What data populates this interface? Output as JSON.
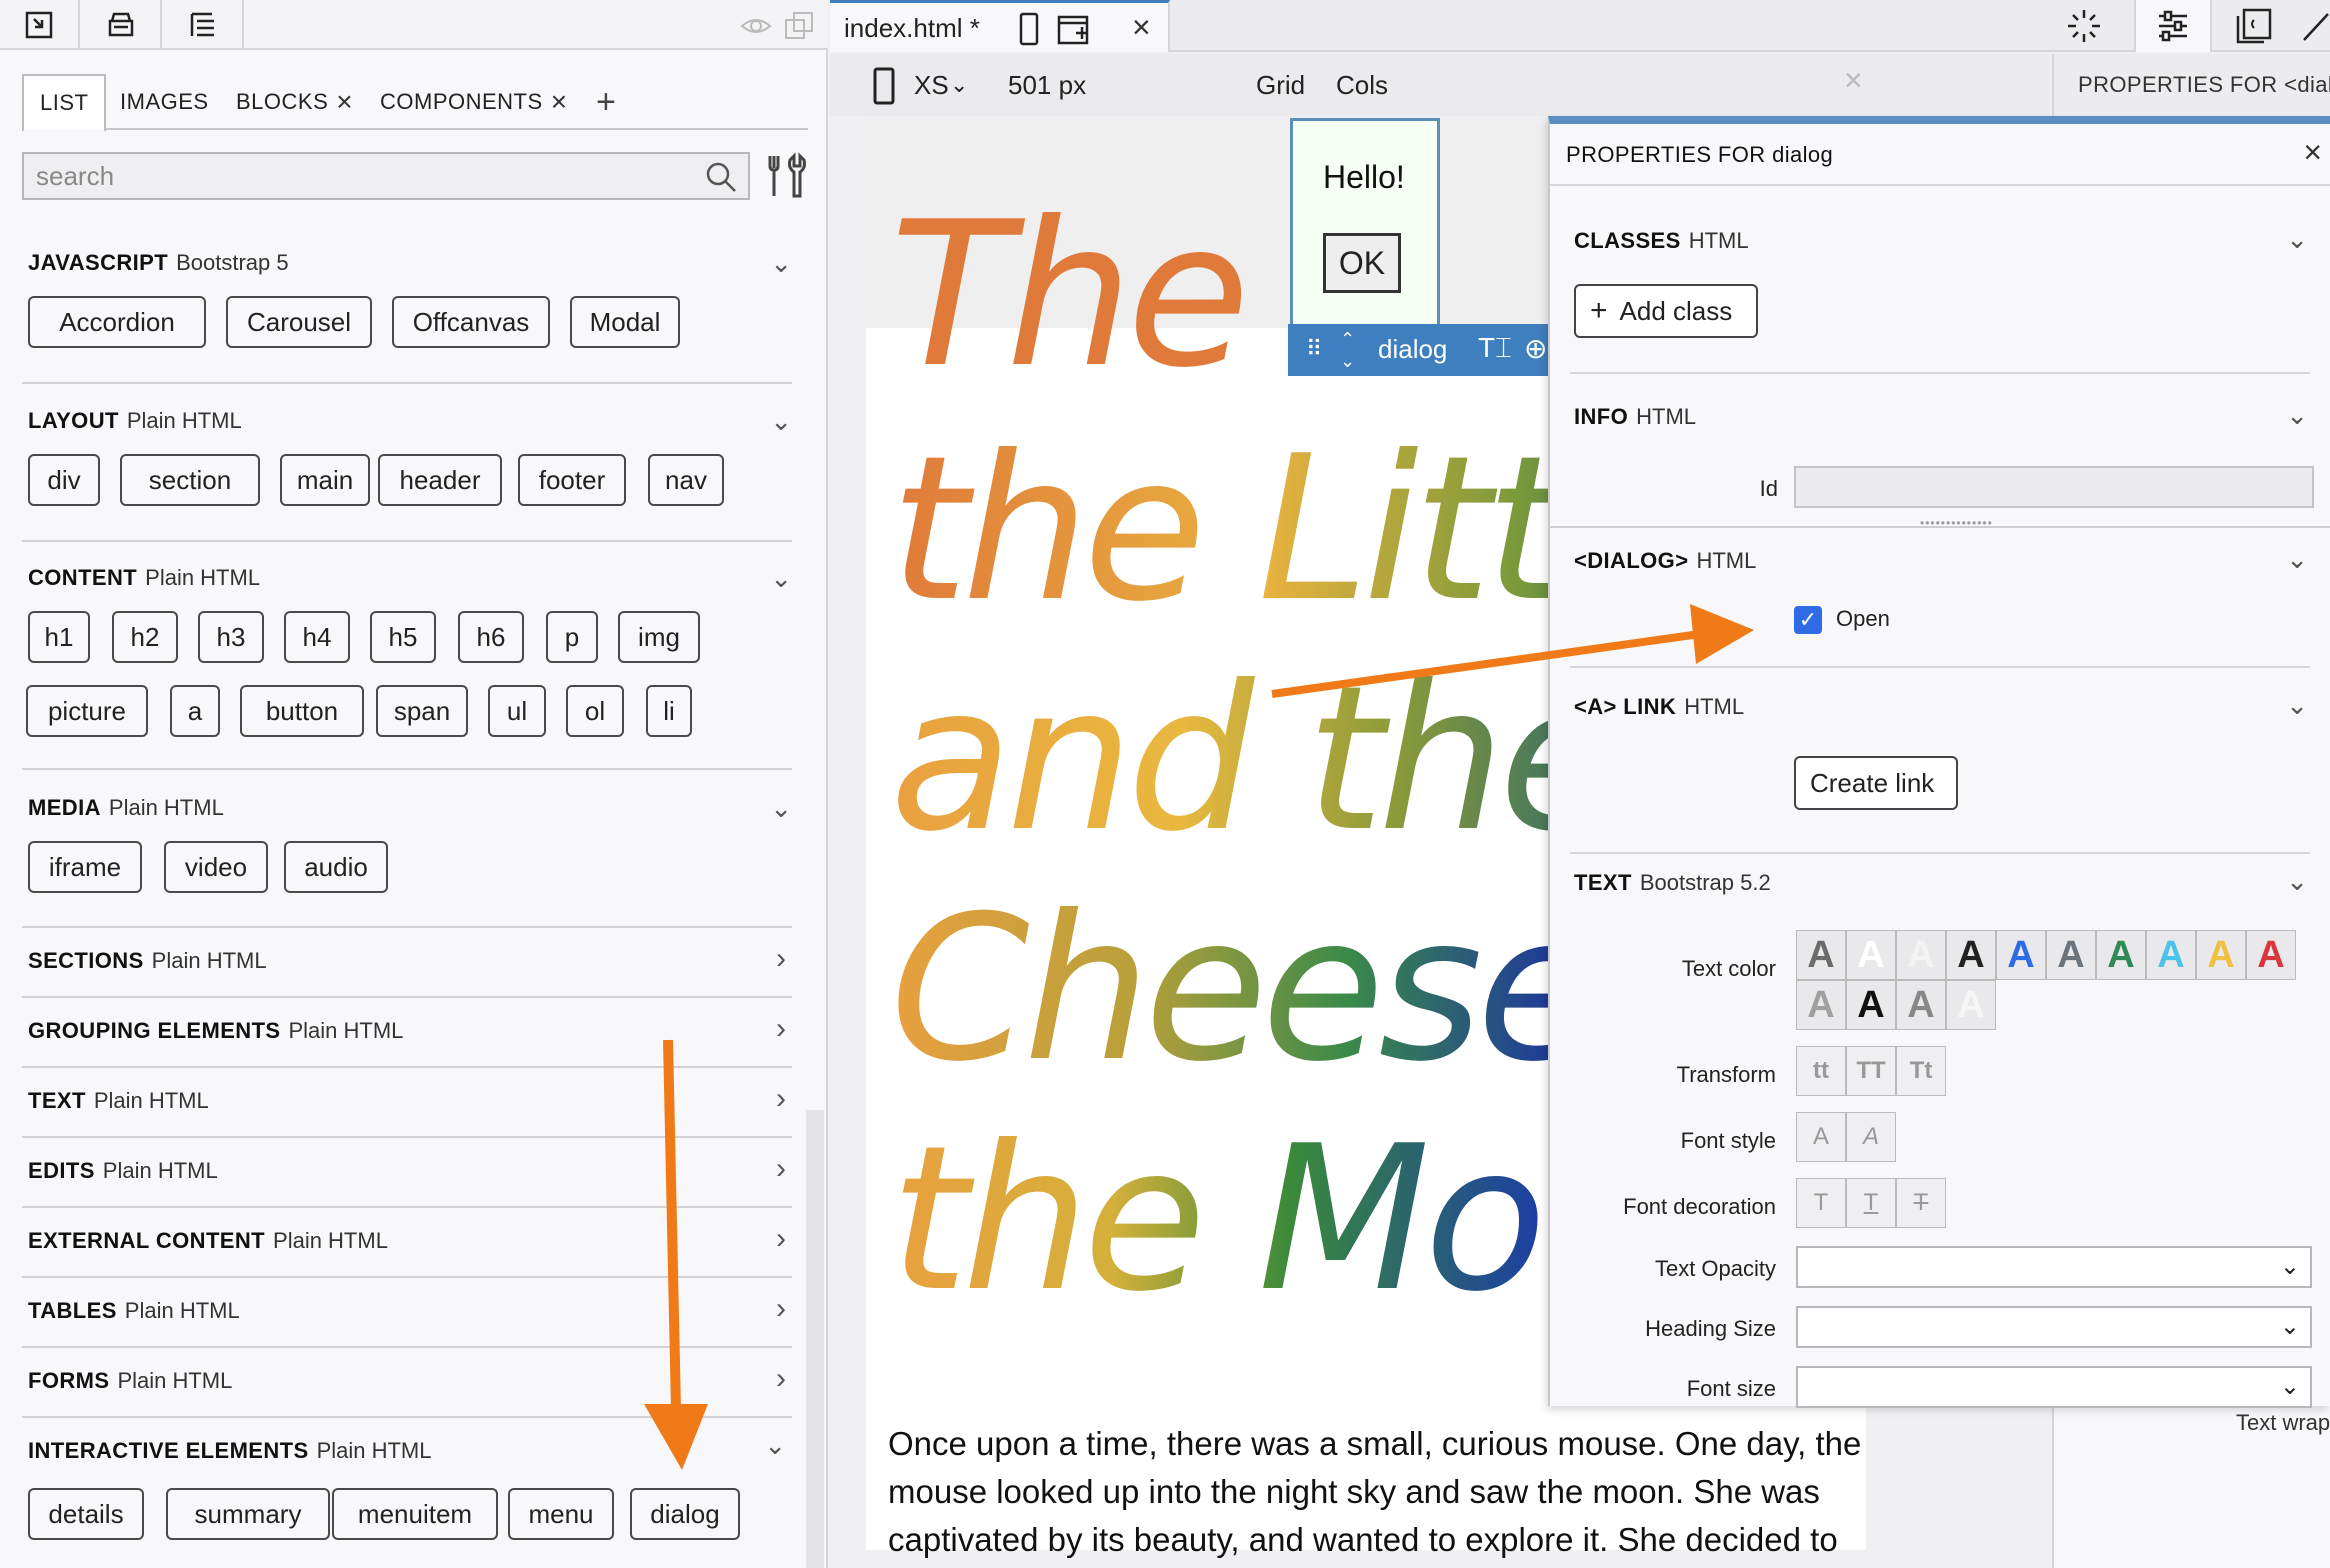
{
  "left_panel": {
    "tabs": [
      {
        "label": "LIST",
        "closable": false
      },
      {
        "label": "IMAGES",
        "closable": false
      },
      {
        "label": "BLOCKS",
        "closable": true
      },
      {
        "label": "COMPONENTS",
        "closable": true
      }
    ],
    "add_tab": "+",
    "search_placeholder": "search",
    "sections": [
      {
        "title": "JAVASCRIPT",
        "sub": "Bootstrap 5",
        "items": [
          "Accordion",
          "Carousel",
          "Offcanvas",
          "Modal"
        ]
      },
      {
        "title": "LAYOUT",
        "sub": "Plain HTML",
        "items": [
          "div",
          "section",
          "main",
          "header",
          "footer",
          "nav"
        ]
      },
      {
        "title": "CONTENT",
        "sub": "Plain HTML",
        "items": [
          "h1",
          "h2",
          "h3",
          "h4",
          "h5",
          "h6",
          "p",
          "img",
          "picture",
          "a",
          "button",
          "span",
          "ul",
          "ol",
          "li"
        ]
      },
      {
        "title": "MEDIA",
        "sub": "Plain HTML",
        "items": [
          "iframe",
          "video",
          "audio"
        ]
      }
    ],
    "collapsed_sections": [
      {
        "title": "SECTIONS",
        "sub": "Plain HTML"
      },
      {
        "title": "GROUPING ELEMENTS",
        "sub": "Plain HTML"
      },
      {
        "title": "TEXT",
        "sub": "Plain HTML"
      },
      {
        "title": "EDITS",
        "sub": "Plain HTML"
      },
      {
        "title": "EXTERNAL CONTENT",
        "sub": "Plain HTML"
      },
      {
        "title": "TABLES",
        "sub": "Plain HTML"
      },
      {
        "title": "FORMS",
        "sub": "Plain HTML"
      }
    ],
    "interactive": {
      "title": "INTERACTIVE ELEMENTS",
      "sub": "Plain HTML",
      "items": [
        "details",
        "summary",
        "menuitem",
        "menu",
        "dialog"
      ]
    }
  },
  "editor": {
    "file_tab": "index.html *",
    "viewport": {
      "breakpoint": "XS",
      "width": "501 px",
      "grid": "Grid",
      "cols": "Cols"
    },
    "headline_lines": [
      "The Tale of",
      "the Little",
      "and the",
      "Cheese of",
      "the Moon"
    ],
    "headline_visible": [
      "The T",
      "the Little",
      "and the",
      "Cheese",
      "the Moon"
    ],
    "story": "Once upon a time, there was a small, curious mouse. One day, the mouse looked up into the night sky and saw the moon. She was captivated by its beauty, and wanted to explore it. She decided to",
    "dialog": {
      "hello": "Hello!",
      "ok": "OK",
      "label": "dialog"
    }
  },
  "properties": {
    "title": "PROPERTIES FOR dialog",
    "classes": {
      "title": "CLASSES",
      "sub": "HTML",
      "add": "Add class"
    },
    "info": {
      "title": "INFO",
      "sub": "HTML",
      "id_label": "Id"
    },
    "dialog_sec": {
      "title": "<DIALOG>",
      "sub": "HTML",
      "open_label": "Open",
      "open_checked": true
    },
    "link_sec": {
      "title": "<A> LINK",
      "sub": "HTML",
      "create": "Create link"
    },
    "text_sec": {
      "title": "TEXT",
      "sub": "Bootstrap 5.2",
      "text_color": "Text color",
      "transform": "Transform",
      "font_style": "Font style",
      "font_decoration": "Font decoration",
      "text_opacity": "Text Opacity",
      "heading_size": "Heading Size",
      "font_size": "Font size"
    },
    "swatch_colors": [
      "#777777",
      "#ffffff",
      "#f1f1f1",
      "#222222",
      "#2f6be6",
      "#6c757d",
      "#2e8b57",
      "#4cc3e8",
      "#f0c040",
      "#d9363e",
      "#a0a0a0",
      "#111111",
      "#888888",
      "#f6f6f6"
    ],
    "transform_options": [
      "tt",
      "TT",
      "Tt"
    ],
    "font_style_options": [
      "A",
      "A"
    ],
    "decoration_options": [
      "T",
      "T",
      "T"
    ]
  },
  "right_panel": {
    "title": "PROPERTIES FOR <dialog>",
    "text_wrap": "Text wrap"
  },
  "colors": {
    "accent": "#3d7fbf",
    "arrow": "#f07a18"
  }
}
